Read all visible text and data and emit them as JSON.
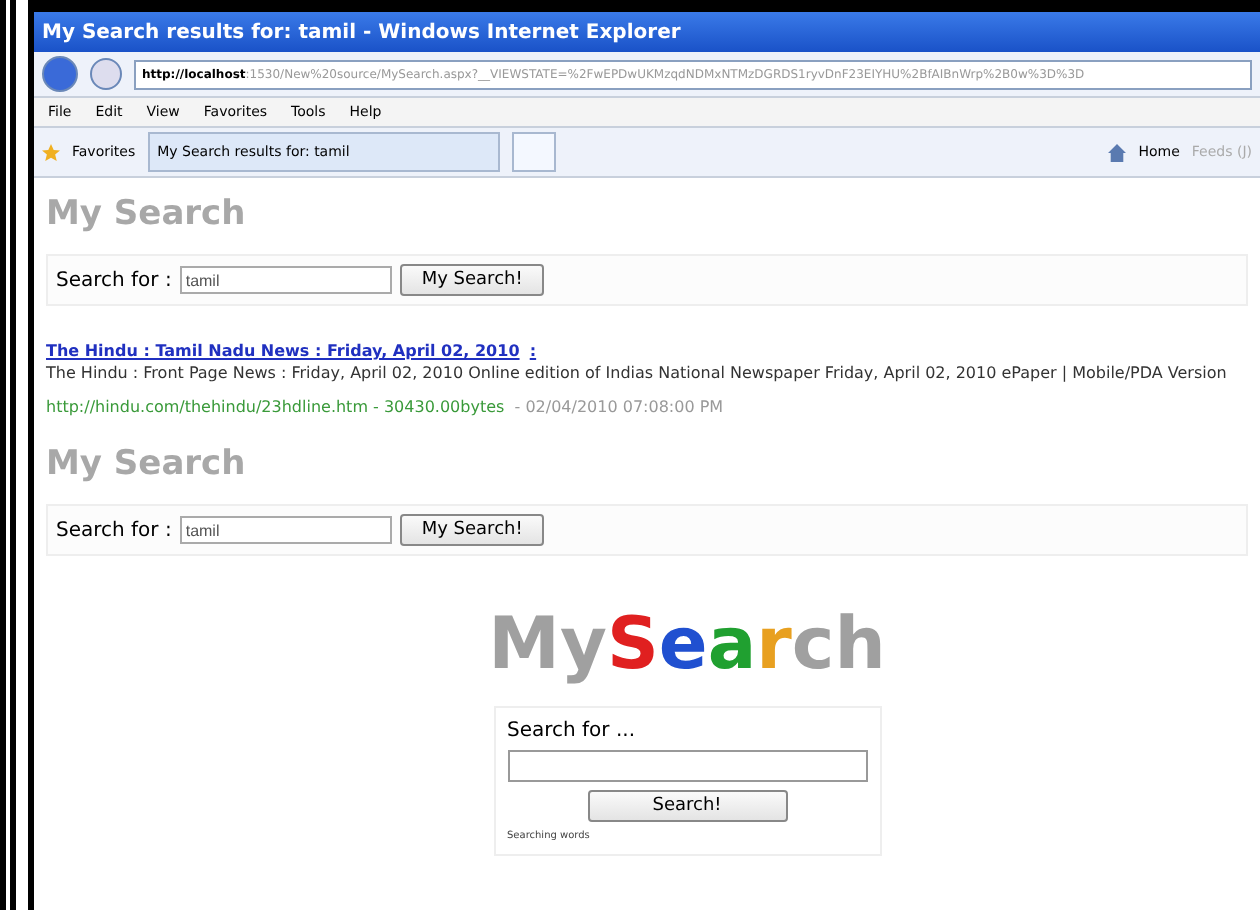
{
  "window": {
    "title": "My Search results for: tamil - Windows Internet Explorer"
  },
  "address_bar": {
    "host": "http://localhost",
    "path": ":1530/New%20source/MySearch.aspx?__VIEWSTATE=%2FwEPDwUKMzqdNDMxNTMzDGRDS1ryvDnF23EIYHU%2BfAIBnWrp%2B0w%3D%3D"
  },
  "menu": [
    "File",
    "Edit",
    "View",
    "Favorites",
    "Tools",
    "Help"
  ],
  "favorites_bar": {
    "favorites": "Favorites",
    "tab": "My Search results for: tamil",
    "home": "Home",
    "feeds": "Feeds (J)"
  },
  "sections": [
    {
      "heading": "My Search",
      "label": "Search for :",
      "value": "tamil",
      "button": "My Search!"
    }
  ],
  "result": {
    "title": "The Hindu : Tamil Nadu News : Friday, April 02, 2010",
    "sep": ":",
    "snippet": "The Hindu : Front Page News : Friday, April 02, 2010 Online edition of Indias National Newspaper Friday, April 02, 2010 ePaper | Mobile/PDA Version",
    "url": "http://hindu.com/thehindu/23hdline.htm - 30430.00bytes",
    "date": "- 02/04/2010 07:08:00 PM"
  },
  "second_section": {
    "heading": "My Search",
    "label": "Search for :",
    "value": "tamil",
    "button": "My Search!"
  },
  "home_box": {
    "logo": [
      {
        "text": "My",
        "color": "#a0a0a0"
      },
      {
        "text": "S",
        "color": "#e02020"
      },
      {
        "text": "e",
        "color": "#2050d0"
      },
      {
        "text": "a",
        "color": "#20a030"
      },
      {
        "text": "r",
        "color": "#e8a020"
      },
      {
        "text": "ch",
        "color": "#a0a0a0"
      }
    ],
    "label": "Search for ...",
    "button": "Search!",
    "note": "Searching words"
  }
}
